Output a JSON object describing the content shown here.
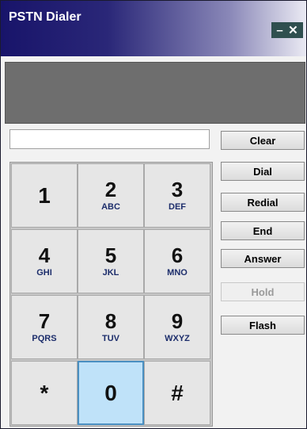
{
  "window": {
    "title": "PSTN Dialer",
    "minimize_glyph": "–",
    "close_glyph": "✕"
  },
  "number_input": {
    "value": "",
    "placeholder": ""
  },
  "buttons": {
    "clear": "Clear",
    "dial": "Dial",
    "redial": "Redial",
    "end": "End",
    "answer": "Answer",
    "hold": "Hold",
    "flash": "Flash"
  },
  "keypad": {
    "keys": [
      {
        "digit": "1",
        "letters": ""
      },
      {
        "digit": "2",
        "letters": "ABC"
      },
      {
        "digit": "3",
        "letters": "DEF"
      },
      {
        "digit": "4",
        "letters": "GHI"
      },
      {
        "digit": "5",
        "letters": "JKL"
      },
      {
        "digit": "6",
        "letters": "MNO"
      },
      {
        "digit": "7",
        "letters": "PQRS"
      },
      {
        "digit": "8",
        "letters": "TUV"
      },
      {
        "digit": "9",
        "letters": "WXYZ"
      },
      {
        "digit": "*",
        "letters": ""
      },
      {
        "digit": "0",
        "letters": ""
      },
      {
        "digit": "#",
        "letters": ""
      }
    ],
    "active_key": "0"
  },
  "colors": {
    "active_key_bg": "#bfe2f9",
    "letters": "#1c2d6b",
    "display": "#6e6e6e"
  }
}
